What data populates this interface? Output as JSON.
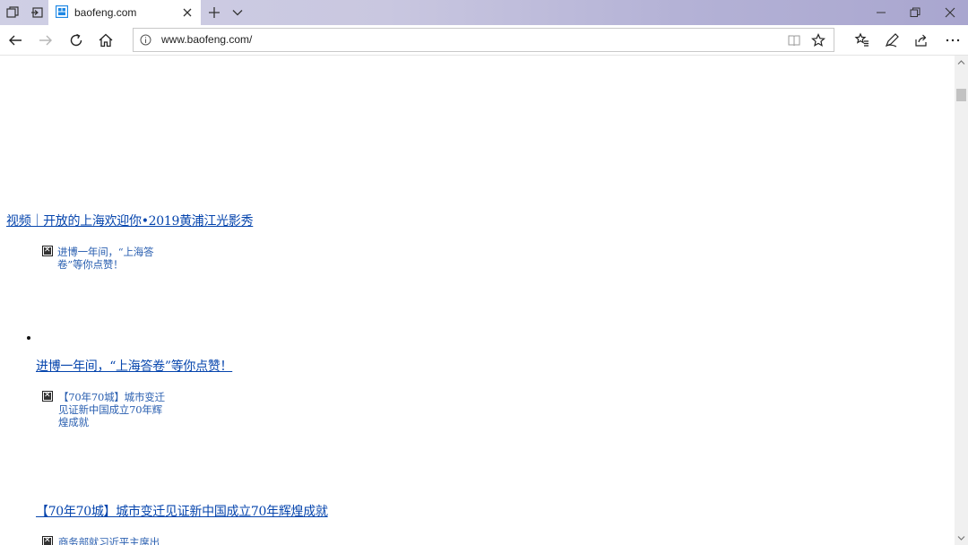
{
  "browser": {
    "tab": {
      "title": "baofeng.com"
    },
    "address": {
      "url": "www.baofeng.com/"
    }
  },
  "page": {
    "headline_link": "视频｜开放的上海欢迎你•2019黄浦江光影秀",
    "items": [
      {
        "image_alt": "进博一年间，“上海答卷”等你点赞！",
        "link": "进博一年间，“上海答卷”等你点赞！"
      },
      {
        "image_alt": "【70年70城】城市变迁见证新中国成立70年辉煌成就",
        "link": "【70年70城】城市变迁见证新中国成立70年辉煌成就"
      },
      {
        "image_alt": "商务部就习近平主席出"
      }
    ]
  },
  "colors": {
    "link": "#0645ad",
    "alt_text": "#2a5fb0",
    "titlebar": "#c9c7e0"
  },
  "icons": [
    "tab-manager-icon",
    "set-aside-tabs-icon",
    "new-tab-icon",
    "tab-list-icon",
    "minimize-icon",
    "restore-icon",
    "close-icon",
    "back-icon",
    "forward-icon",
    "refresh-icon",
    "home-icon",
    "site-info-icon",
    "reading-view-icon",
    "favorite-star-icon",
    "favorites-hub-icon",
    "add-notes-icon",
    "share-icon",
    "more-icon",
    "broken-image-icon"
  ]
}
